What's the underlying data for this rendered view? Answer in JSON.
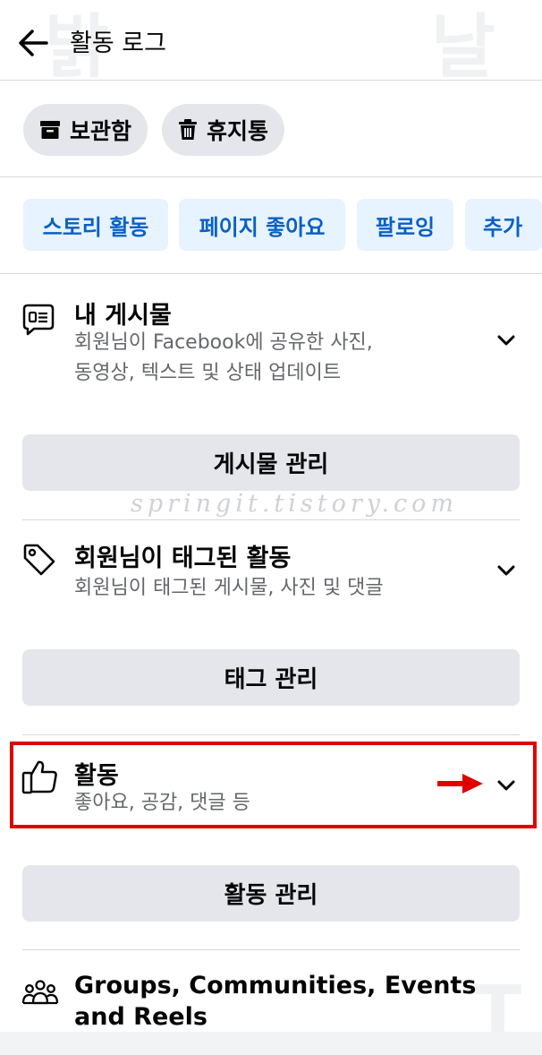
{
  "header": {
    "title": "활동 로그",
    "back_icon": "arrow-left-icon"
  },
  "actions": [
    {
      "label": "보관함",
      "icon": "archive-icon"
    },
    {
      "label": "휴지통",
      "icon": "trash-icon"
    }
  ],
  "filters": [
    "스토리 활동",
    "페이지 좋아요",
    "팔로잉",
    "추가"
  ],
  "sections": [
    {
      "title": "내 게시물",
      "subtitle_lines": [
        "회원님이 Facebook에 공유한 사진,",
        "동영상, 텍스트 및 상태 업데이트"
      ],
      "icon": "post-speech-bubble-icon",
      "manage_label": "게시물 관리"
    },
    {
      "title": "회원님이 태그된 활동",
      "subtitle_lines": [
        "회원님이 태그된 게시물, 사진 및 댓글"
      ],
      "icon": "tag-icon",
      "manage_label": "태그 관리"
    },
    {
      "title": "활동",
      "subtitle_lines": [
        "좋아요, 공감, 댓글 등"
      ],
      "icon": "thumbs-up-icon",
      "manage_label": "활동 관리"
    },
    {
      "title_lines": [
        "Groups, Communities, Events",
        "and Reels"
      ],
      "icon": "groups-icon"
    }
  ],
  "watermark": "springit.tistory.com",
  "colors": {
    "filter_bg": "#e7f3ff",
    "filter_text": "#0a60c4",
    "chip_bg": "#e4e6eb",
    "highlight": "#e00000"
  }
}
